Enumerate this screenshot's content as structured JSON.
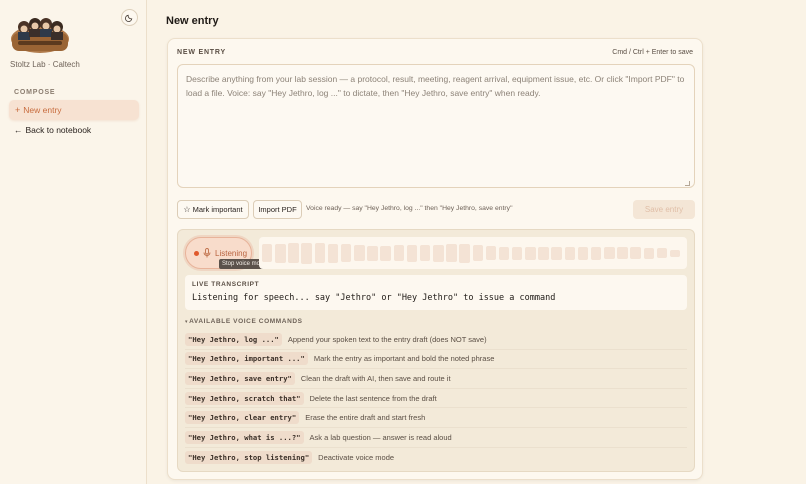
{
  "sidebar": {
    "lab_name": "Stoltz Lab · Caltech",
    "section_label": "COMPOSE",
    "new_entry": "New entry",
    "back_link": "Back to notebook"
  },
  "page": {
    "title": "New entry"
  },
  "card": {
    "label": "NEW ENTRY",
    "shortcut_hint": "Cmd / Ctrl + Enter to save",
    "placeholder": "Describe anything from your lab session — a protocol, result, meeting, reagent arrival, equipment issue, etc. Or click \"Import PDF\" to load a file. Voice: say \"Hey Jethro, log ...\" to dictate, then \"Hey Jethro, save entry\" when ready.",
    "mark_important": "Mark important",
    "import_pdf": "Import PDF",
    "voice_status": "Voice ready — say \"Hey Jethro, log ...\" then \"Hey Jethro, save entry\"",
    "save_entry": "Save entry"
  },
  "voice": {
    "listening_label": "Listening",
    "tooltip": "Stop voice mode",
    "waveform_levels": [
      0.55,
      0.6,
      0.62,
      0.65,
      0.62,
      0.58,
      0.55,
      0.5,
      0.48,
      0.48,
      0.5,
      0.52,
      0.5,
      0.52,
      0.55,
      0.58,
      0.5,
      0.45,
      0.42,
      0.42,
      0.42,
      0.4,
      0.42,
      0.42,
      0.4,
      0.4,
      0.38,
      0.38,
      0.38,
      0.35,
      0.3,
      0.22
    ],
    "transcript_label": "LIVE TRANSCRIPT",
    "transcript_text": "Listening for speech... say \"Jethro\" or \"Hey Jethro\" to issue a command",
    "commands_label": "AVAILABLE VOICE COMMANDS",
    "commands": [
      {
        "code": "\"Hey Jethro, log ...\"",
        "desc": "Append your spoken text to the entry draft (does NOT save)"
      },
      {
        "code": "\"Hey Jethro, important ...\"",
        "desc": "Mark the entry as important and bold the noted phrase"
      },
      {
        "code": "\"Hey Jethro, save entry\"",
        "desc": "Clean the draft with AI, then save and route it"
      },
      {
        "code": "\"Hey Jethro, scratch that\"",
        "desc": "Delete the last sentence from the draft"
      },
      {
        "code": "\"Hey Jethro, clear entry\"",
        "desc": "Erase the entire draft and start fresh"
      },
      {
        "code": "\"Hey Jethro, what is ...?\"",
        "desc": "Ask a lab question — answer is read aloud"
      },
      {
        "code": "\"Hey Jethro, stop listening\"",
        "desc": "Deactivate voice mode"
      }
    ]
  },
  "colors": {
    "accent": "#c86c3e",
    "record": "#e0592c",
    "background": "#faf3e6"
  }
}
